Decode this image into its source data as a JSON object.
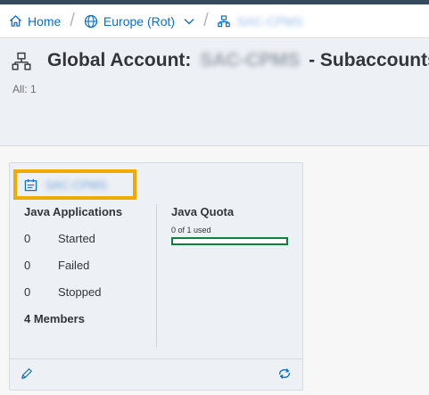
{
  "breadcrumb": {
    "home_label": "Home",
    "region_label": "Europe (Rot)",
    "account_label": "SAC-CPMS"
  },
  "header": {
    "title_prefix": "Global Account:",
    "title_account": "SAC-CPMS",
    "title_suffix": "- Subaccounts",
    "count_label": "All: 1"
  },
  "tile": {
    "name": "SAC-CPMS",
    "java_apps_title": "Java Applications",
    "stats": [
      {
        "value": "0",
        "label": "Started"
      },
      {
        "value": "0",
        "label": "Failed"
      },
      {
        "value": "0",
        "label": "Stopped"
      }
    ],
    "members": "4 Members",
    "quota_title": "Java Quota",
    "quota_used_text": "0 of 1 used",
    "quota_used": 0,
    "quota_total": 1
  },
  "colors": {
    "accent": "#0a6ed1",
    "highlight": "#f0ab00",
    "quota_bar": "#107e3e"
  },
  "icons": {
    "home": "home-icon",
    "globe": "globe-icon",
    "hierarchy": "hierarchy-icon",
    "subaccount": "subaccount-icon",
    "edit": "pencil-icon",
    "refresh": "refresh-icon"
  }
}
